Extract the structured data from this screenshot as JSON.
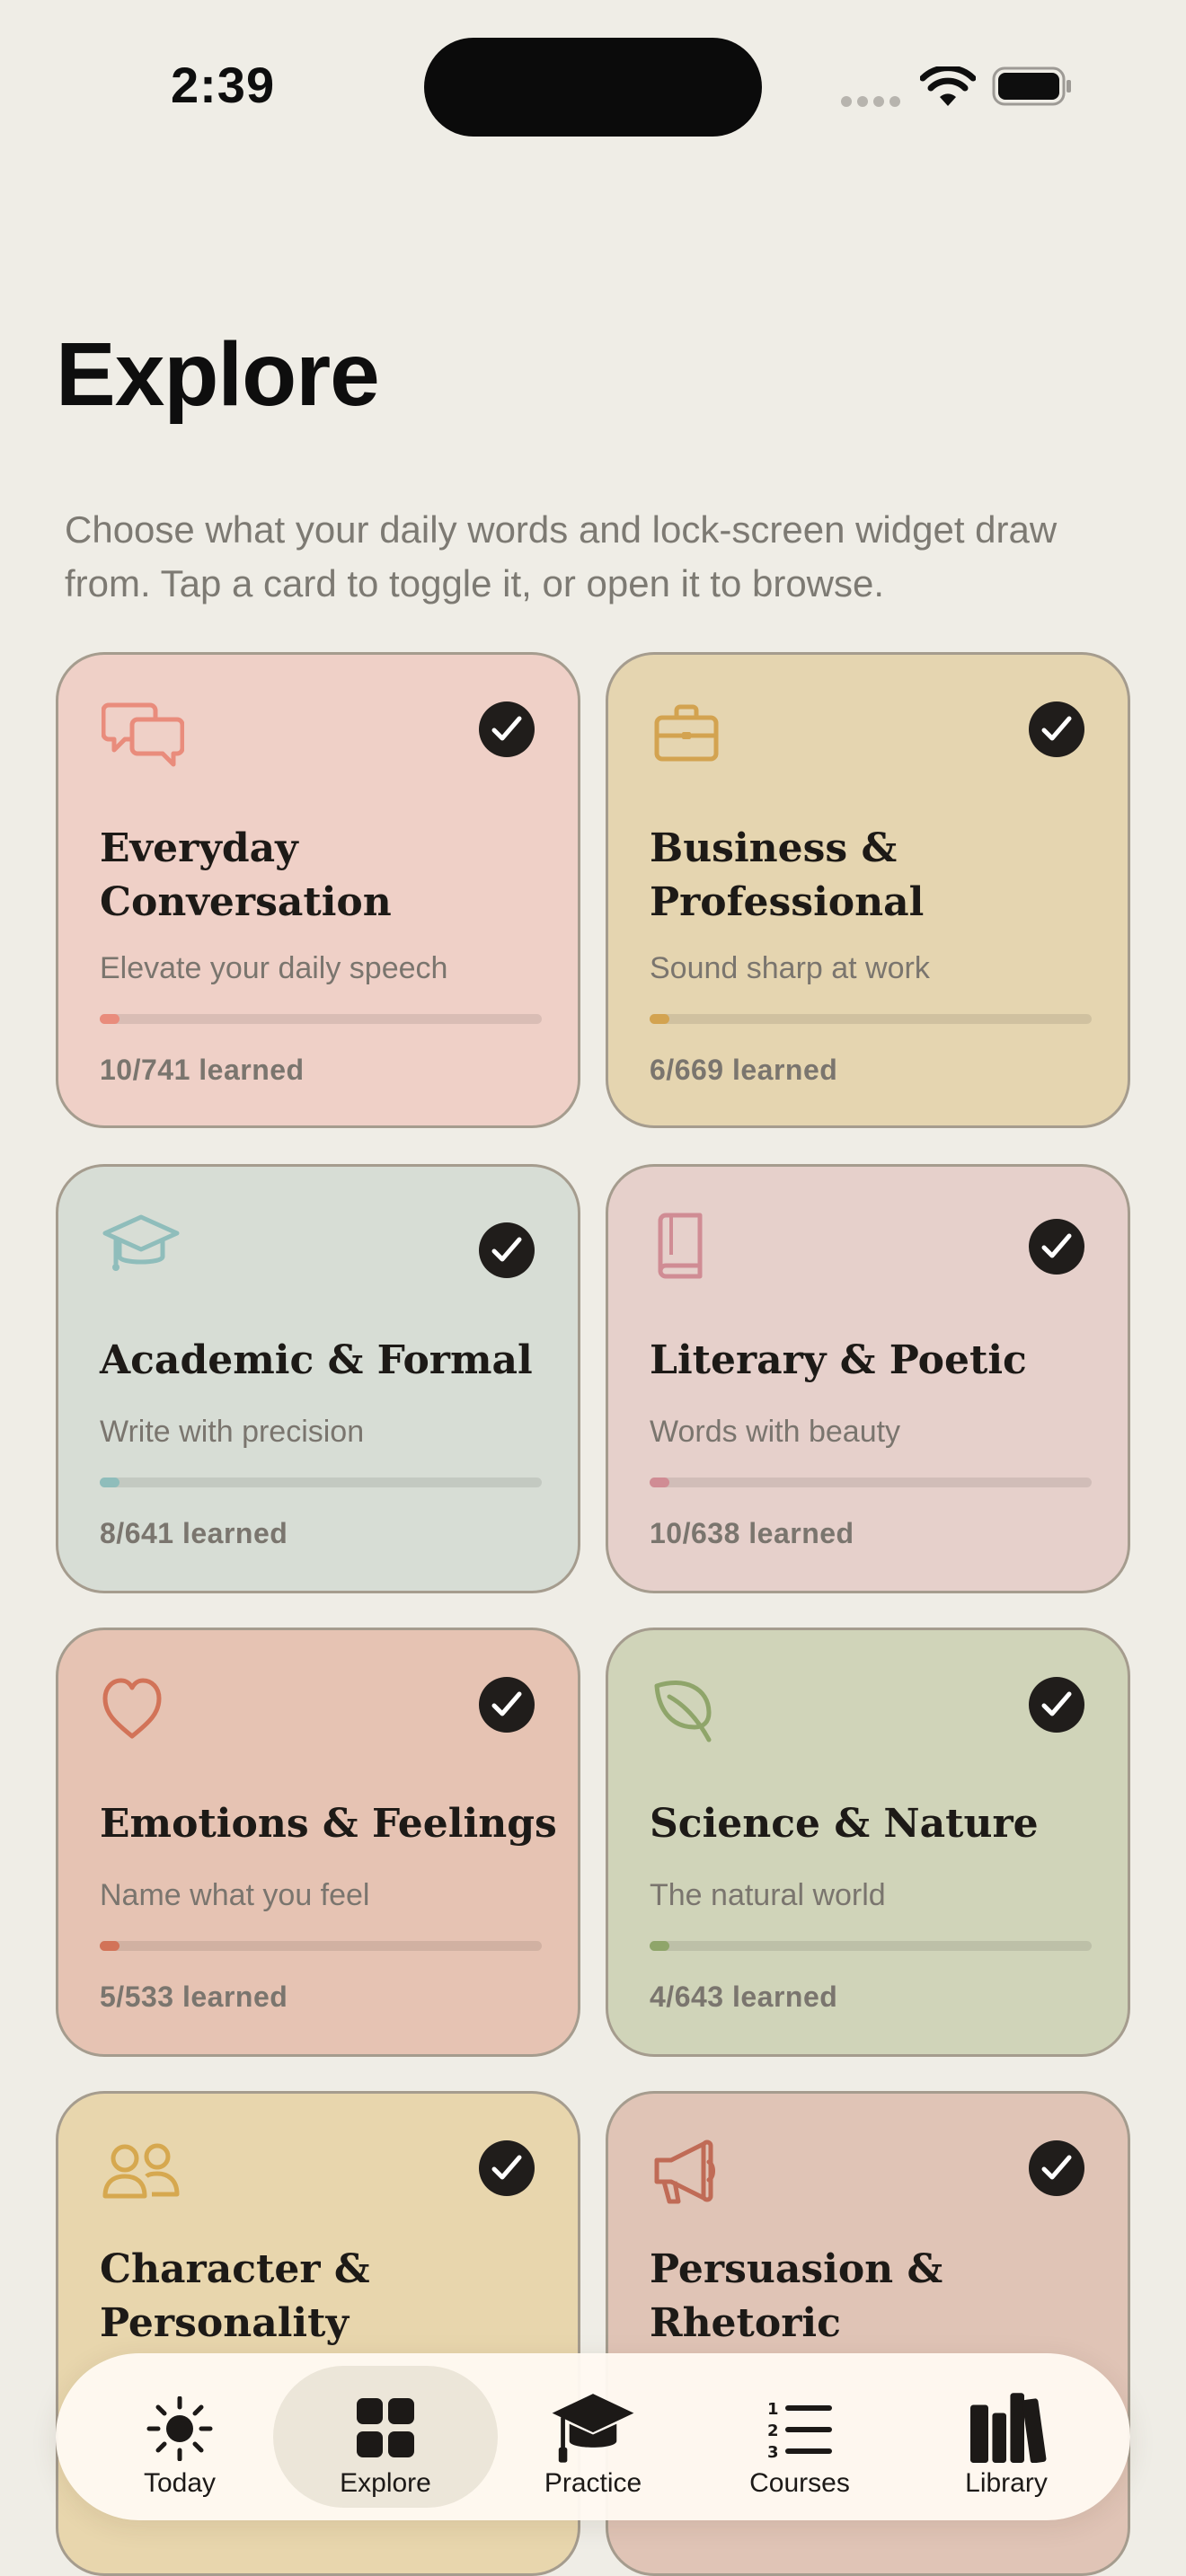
{
  "status_bar": {
    "time": "2:39"
  },
  "header": {
    "title": "Explore",
    "subtitle": "Choose what your daily words and lock-screen widget draw from. Tap a card to toggle it, or open it to browse."
  },
  "categories": [
    {
      "title": "Everyday Conversation",
      "description": "Elevate your daily speech",
      "learned": "10/741 learned",
      "progress": 0.0135,
      "icon": "chat-bubbles-icon",
      "selected": true,
      "bg": "#EFD0C7",
      "accent": "#E98C7C"
    },
    {
      "title": "Business & Professional",
      "description": "Sound sharp at work",
      "learned": "6/669 learned",
      "progress": 0.009,
      "icon": "briefcase-icon",
      "selected": true,
      "bg": "#E5D5B0",
      "accent": "#D3A350"
    },
    {
      "title": "Academic & Formal",
      "description": "Write with precision",
      "learned": "8/641 learned",
      "progress": 0.0125,
      "icon": "graduation-cap-icon",
      "selected": true,
      "bg": "#D7DDD5",
      "accent": "#8FBDBB"
    },
    {
      "title": "Literary & Poetic",
      "description": "Words with beauty",
      "learned": "10/638 learned",
      "progress": 0.0157,
      "icon": "book-icon",
      "selected": true,
      "bg": "#E6D0CB",
      "accent": "#D08C94"
    },
    {
      "title": "Emotions & Feelings",
      "description": "Name what you feel",
      "learned": "5/533 learned",
      "progress": 0.0094,
      "icon": "heart-icon",
      "selected": true,
      "bg": "#E6C3B3",
      "accent": "#D27358"
    },
    {
      "title": "Science & Nature",
      "description": "The natural world",
      "learned": "4/643 learned",
      "progress": 0.0062,
      "icon": "leaf-icon",
      "selected": true,
      "bg": "#D0D4B9",
      "accent": "#8FA56A"
    },
    {
      "title": "Character & Personality",
      "description": "",
      "learned": "",
      "progress": 0,
      "icon": "people-icon",
      "selected": true,
      "bg": "#E8D6AD",
      "accent": "#D6A84F"
    },
    {
      "title": "Persuasion & Rhetoric",
      "description": "",
      "learned": "",
      "progress": 0,
      "icon": "megaphone-icon",
      "selected": true,
      "bg": "#E0C4B6",
      "accent": "#C06B56"
    }
  ],
  "tabs": [
    {
      "label": "Today",
      "icon": "sun-icon",
      "active": false
    },
    {
      "label": "Explore",
      "icon": "grid-icon",
      "active": true
    },
    {
      "label": "Practice",
      "icon": "graduation-cap-icon",
      "active": false
    },
    {
      "label": "Courses",
      "icon": "numbered-list-icon",
      "active": false
    },
    {
      "label": "Library",
      "icon": "books-icon",
      "active": false
    }
  ]
}
